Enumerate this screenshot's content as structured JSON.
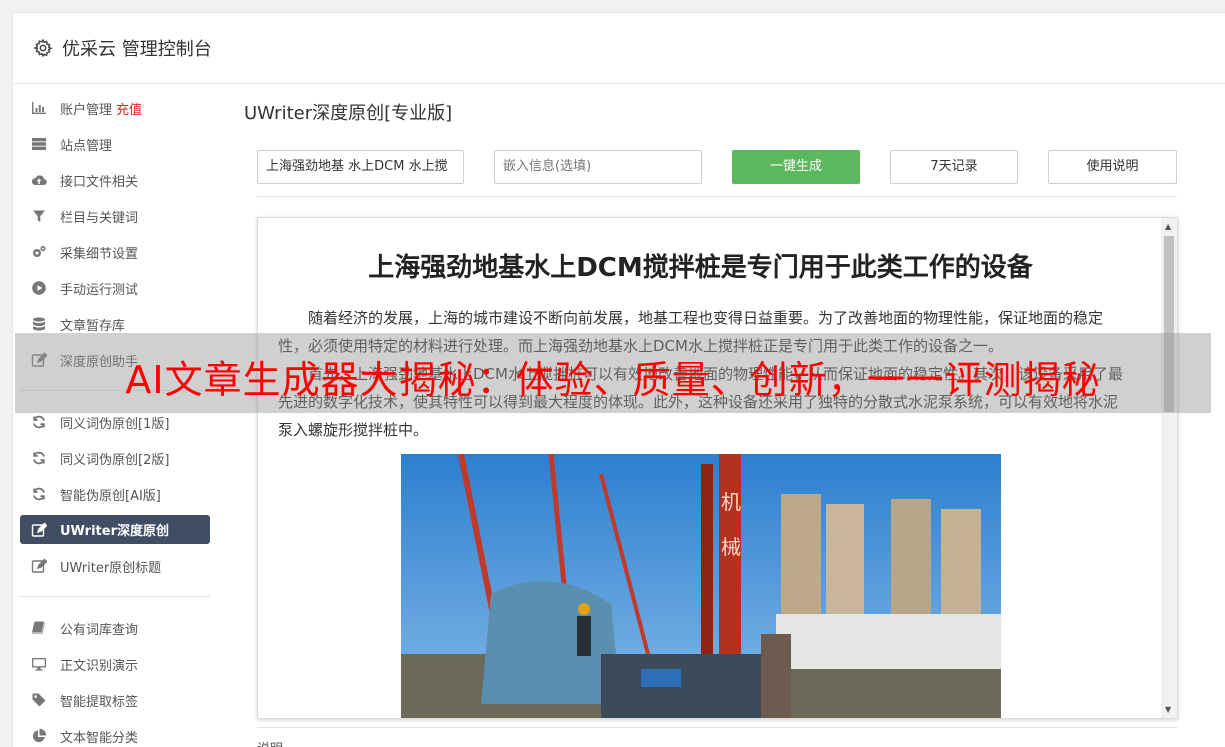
{
  "app": {
    "title": "优采云 管理控制台",
    "icon": "gear-icon"
  },
  "sidebar": {
    "group1": [
      {
        "label": "账户管理",
        "extra": "充值",
        "icon": "bar-chart-icon"
      },
      {
        "label": "站点管理",
        "icon": "server-icon"
      },
      {
        "label": "接口文件相关",
        "icon": "cloud-upload-icon"
      },
      {
        "label": "栏目与关键词",
        "icon": "filter-icon"
      },
      {
        "label": "采集细节设置",
        "icon": "cogs-icon"
      },
      {
        "label": "手动运行测试",
        "icon": "play-circle-icon"
      },
      {
        "label": "文章暂存库",
        "icon": "database-icon"
      },
      {
        "label": "深度原创助手",
        "icon": "edit-icon"
      }
    ],
    "group2": [
      {
        "label": "同义词伪原创[1版]",
        "icon": "refresh-icon"
      },
      {
        "label": "同义词伪原创[2版]",
        "icon": "refresh-icon"
      },
      {
        "label": "智能伪原创[AI版]",
        "icon": "refresh-icon"
      },
      {
        "label": "UWriter深度原创",
        "icon": "edit-icon",
        "active": true
      },
      {
        "label": "UWriter原创标题",
        "icon": "edit-icon"
      }
    ],
    "group3": [
      {
        "label": "公有词库查询",
        "icon": "book-icon"
      },
      {
        "label": "正文识别演示",
        "icon": "monitor-icon"
      },
      {
        "label": "智能提取标签",
        "icon": "tag-icon"
      },
      {
        "label": "文本智能分类",
        "icon": "pie-chart-icon"
      }
    ]
  },
  "main": {
    "heading": "UWriter深度原创[专业版]",
    "keyword_input": {
      "value": "上海强劲地基 水上DCM 水上搅"
    },
    "embed_input": {
      "placeholder": "嵌入信息(选填)"
    },
    "generate_button": "一键生成",
    "history_button": "7天记录",
    "help_button": "使用说明",
    "bottom_label": "说明"
  },
  "article": {
    "title": "上海强劲地基水上DCM搅拌桩是专门用于此类工作的设备",
    "paragraphs": [
      "随着经济的发展，上海的城市建设不断向前发展，地基工程也变得日益重要。为了改善地面的物理性能，保证地面的稳定性，必须使用特定的材料进行处理。而上海强劲地基水上DCM水上搅拌桩正是专门用于此类工作的设备之一。",
      "首先，上海强劲地基水上DCM水上搅拌桩可以有效地改善地面的物理性能，从而保证地面的稳定性。其次，该设备采用了最先进的数字化技术，使其特性可以得到最大程度的体现。此外，这种设备还采用了独特的分散式水泥泵系统，可以有效地将水泥泵入螺旋形搅拌桩中。"
    ],
    "photo_caption_chars": [
      "机",
      "械"
    ]
  },
  "overlay": {
    "banner_text": "AI文章生成器大揭秘：体验、质量、创新，一一评测揭秘"
  },
  "colors": {
    "accent_green": "#5cb85c",
    "sidebar_active": "#3f4e64",
    "recharge_red": "#e5201d",
    "banner_text": "#ff0000"
  }
}
